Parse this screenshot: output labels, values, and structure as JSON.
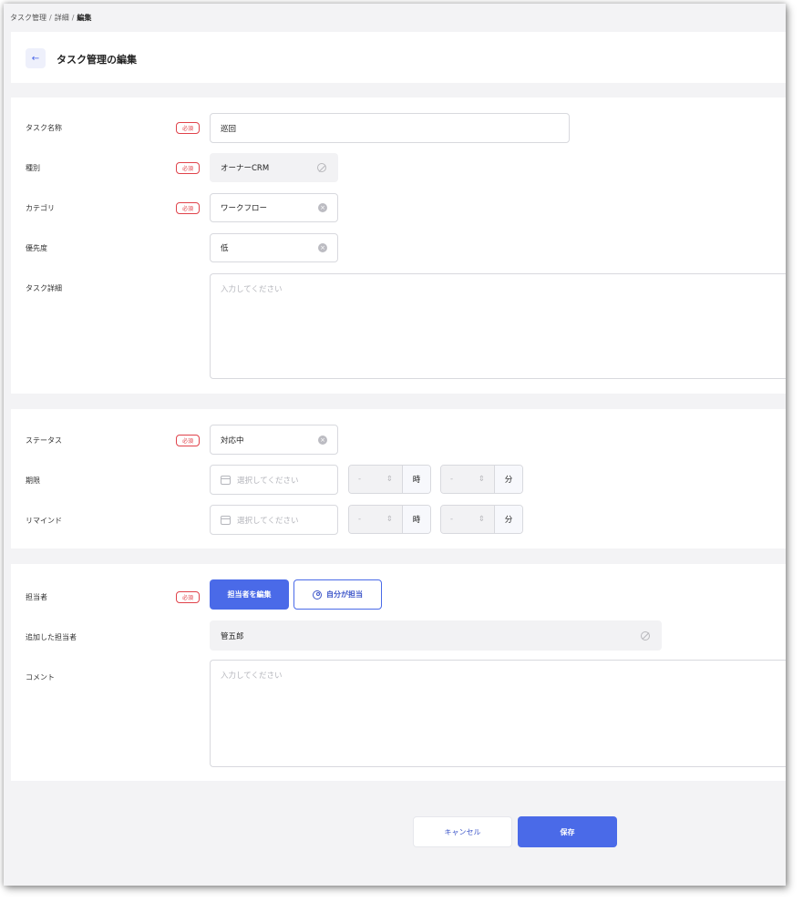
{
  "breadcrumb": {
    "item1": "タスク管理",
    "separator": "/",
    "item2": "詳細",
    "current": "編集"
  },
  "header": {
    "back_icon": "←",
    "title": "タスク管理の編集"
  },
  "required_label": "必須",
  "section1": {
    "task_name": {
      "label": "タスク名称",
      "value": "巡回"
    },
    "type": {
      "label": "種別",
      "value": "オーナーCRM"
    },
    "category": {
      "label": "カテゴリ",
      "value": "ワークフロー"
    },
    "priority": {
      "label": "優先度",
      "value": "低"
    },
    "detail": {
      "label": "タスク詳細",
      "placeholder": "入力してください"
    }
  },
  "section2": {
    "status": {
      "label": "ステータス",
      "value": "対応中"
    },
    "deadline": {
      "label": "期限",
      "date_placeholder": "選択してください",
      "hour_value": "-",
      "hour_unit": "時",
      "minute_value": "-",
      "minute_unit": "分"
    },
    "remind": {
      "label": "リマインド",
      "date_placeholder": "選択してください",
      "hour_value": "-",
      "hour_unit": "時",
      "minute_value": "-",
      "minute_unit": "分"
    }
  },
  "section3": {
    "assignee": {
      "label": "担当者",
      "edit_button": "担当者を編集",
      "self_button": "自分が担当"
    },
    "added_assignee": {
      "label": "追加した担当者",
      "value": "管五郎"
    },
    "comment": {
      "label": "コメント",
      "placeholder": "入力してください"
    }
  },
  "footer": {
    "cancel": "キャンセル",
    "save": "保存"
  },
  "colors": {
    "primary": "#4a6ae8",
    "required": "#e0424a",
    "background": "#f3f3f5"
  },
  "icons": {
    "clear": "×",
    "spinner": "⇕"
  }
}
